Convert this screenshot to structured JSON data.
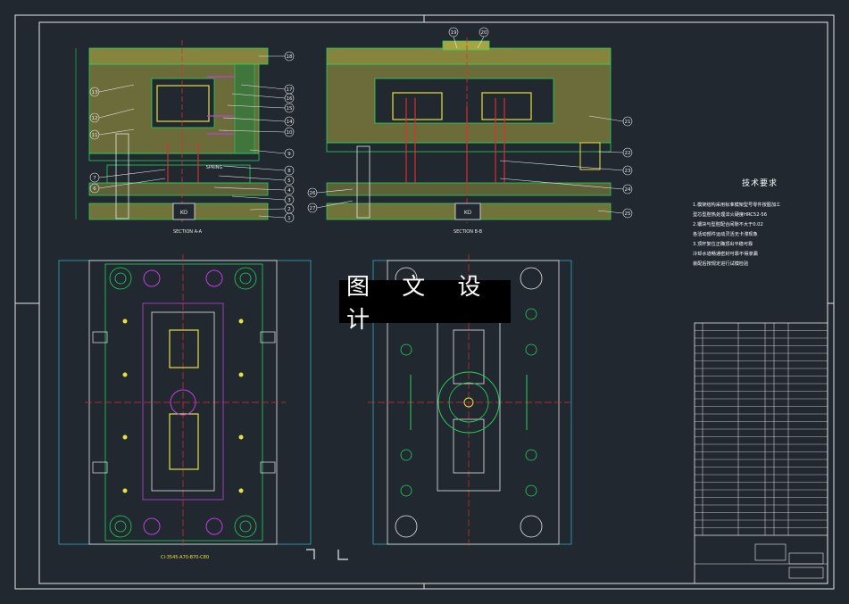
{
  "watermark": {
    "text": "图 文 设 计"
  },
  "notes": {
    "title": "技术要求",
    "lines": [
      "1.模架结构采用标准模架型号零件按图加工",
      "型芯型腔热处理淬火硬度HRC52-56",
      "2.镶块与型腔配合间隙不大于0.02",
      "各活动部件运动灵活无卡滞现象",
      "3.顶杆复位正确顶出平稳可靠",
      "冷却水道畅通密封可靠不得渗漏",
      "装配后按规定进行试模检验"
    ]
  },
  "views": {
    "section_aa": "SECTION A-A",
    "section_bb": "SECTION B-B",
    "bottom_label": "CI-3545-A70-B70-C80",
    "spring_label": "SPRING",
    "kio_a": "KO",
    "kio_b": "KO"
  },
  "balloons_a": [
    "13",
    "12",
    "11",
    "7",
    "6",
    "18",
    "17",
    "16",
    "15",
    "14",
    "10",
    "9",
    "8",
    "5",
    "4",
    "3",
    "2",
    "1"
  ],
  "balloons_b": [
    "19",
    "20",
    "21",
    "22",
    "23",
    "24",
    "25",
    "26",
    "27"
  ],
  "colors": {
    "background": "#212830",
    "frame": "#ffffff",
    "line_green": "#22d35a",
    "hatch": "#a9a442",
    "cyan": "#35d8e8",
    "red": "#d83030",
    "yellow": "#e8e040",
    "magenta": "#c040e0",
    "white": "#e8e8e8"
  },
  "title_block": {
    "rows": 28,
    "field_1": "",
    "field_2": ""
  }
}
